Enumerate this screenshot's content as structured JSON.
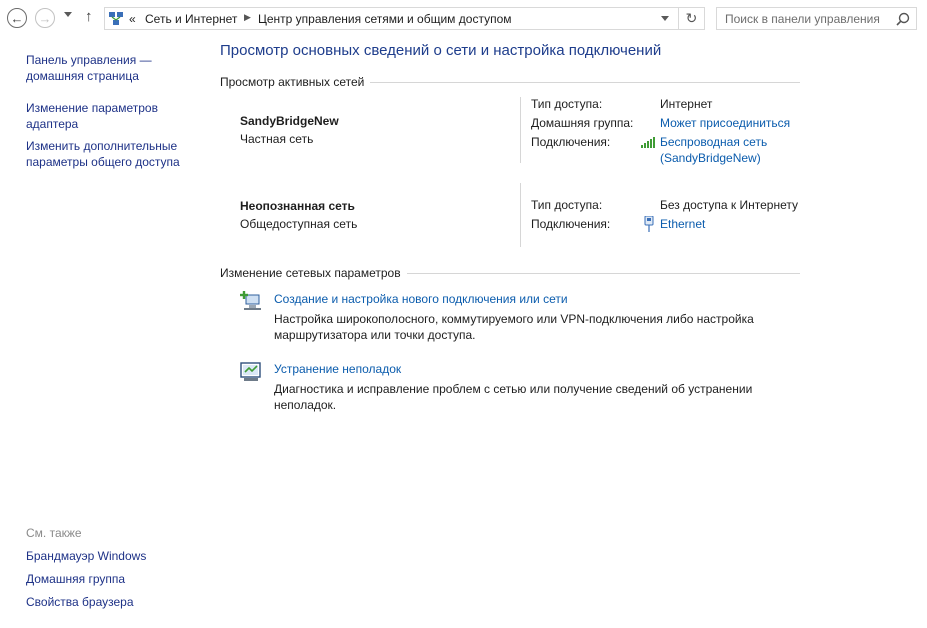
{
  "toolbar": {
    "breadcrumb_prefix": "«",
    "breadcrumb_1": "Сеть и Интернет",
    "breadcrumb_2": "Центр управления сетями и общим доступом",
    "search_placeholder": "Поиск в панели управления"
  },
  "sidebar": {
    "items": [
      {
        "label": "Панель управления — домашняя страница"
      },
      {
        "label": "Изменение параметров адаптера"
      },
      {
        "label": "Изменить дополнительные параметры общего доступа"
      }
    ],
    "see_also_title": "См. также",
    "see_also": [
      {
        "label": "Брандмауэр Windows"
      },
      {
        "label": "Домашняя группа"
      },
      {
        "label": "Свойства браузера"
      }
    ]
  },
  "main": {
    "title": "Просмотр основных сведений о сети и настройка подключений",
    "active_networks_heading": "Просмотр активных сетей",
    "networks": [
      {
        "name": "SandyBridgeNew",
        "type": "Частная сеть",
        "access_label": "Тип доступа:",
        "access_value": "Интернет",
        "homegroup_label": "Домашняя группа:",
        "homegroup_value": "Может присоединиться",
        "connections_label": "Подключения:",
        "connection_line1": "Беспроводная сеть",
        "connection_line2": "(SandyBridgeNew)",
        "connection_icon": "wifi-signal-icon"
      },
      {
        "name": "Неопознанная сеть",
        "type": "Общедоступная сеть",
        "access_label": "Тип доступа:",
        "access_value": "Без доступа к Интернету",
        "connections_label": "Подключения:",
        "connection_line1": "Ethernet",
        "connection_icon": "ethernet-icon"
      }
    ],
    "change_settings_heading": "Изменение сетевых параметров",
    "tasks": [
      {
        "link": "Создание и настройка нового подключения или сети",
        "desc": "Настройка широкополосного, коммутируемого или VPN-подключения либо настройка маршрутизатора или точки доступа.",
        "icon": "new-connection-icon"
      },
      {
        "link": "Устранение неполадок",
        "desc": "Диагностика и исправление проблем с сетью или получение сведений об устранении неполадок.",
        "icon": "troubleshoot-icon"
      }
    ]
  },
  "colors": {
    "link": "#0b5cad",
    "sidebar_link": "#1e3287",
    "title": "#1e3d8c",
    "divider": "#d6d6d6"
  }
}
